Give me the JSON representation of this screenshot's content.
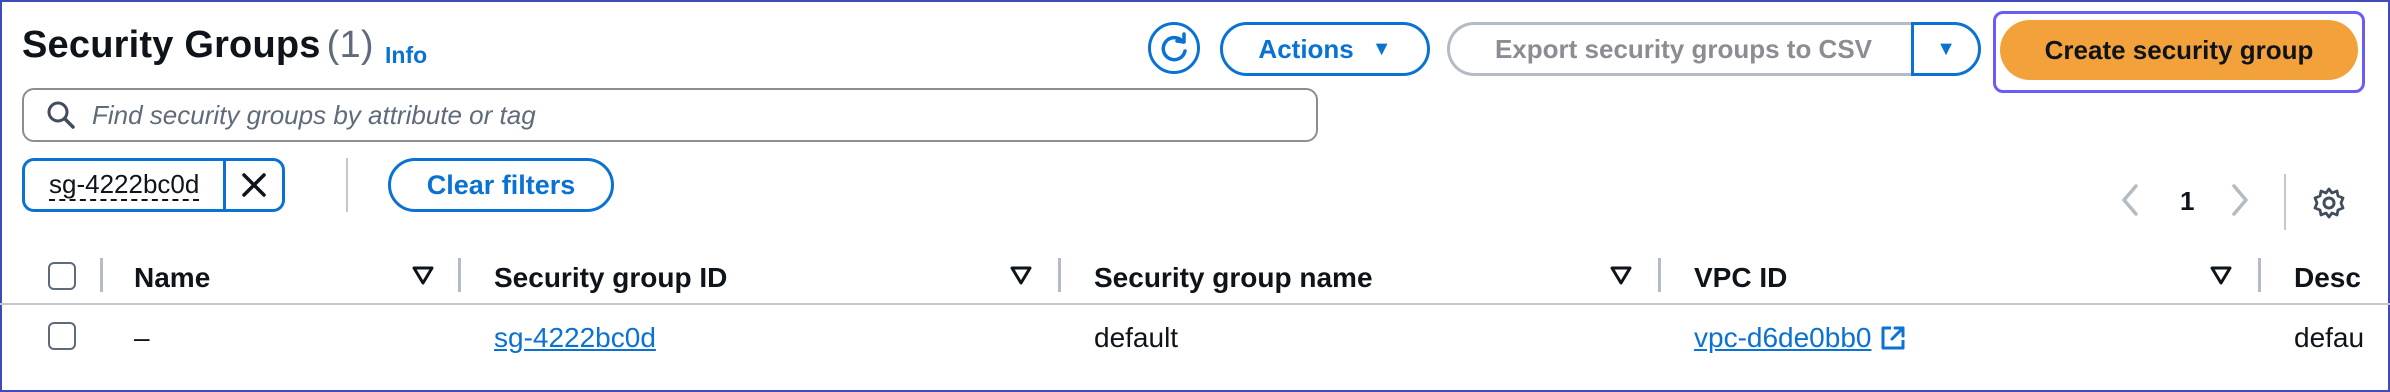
{
  "header": {
    "title": "Security Groups",
    "count": "(1)",
    "info_label": "Info"
  },
  "toolbar": {
    "actions_label": "Actions",
    "export_label": "Export security groups to CSV",
    "create_label": "Create security group"
  },
  "search": {
    "placeholder": "Find security groups by attribute or tag"
  },
  "filters": {
    "token_value": "sg-4222bc0d",
    "clear_label": "Clear filters"
  },
  "pagination": {
    "current_page": "1"
  },
  "table": {
    "columns": [
      "Name",
      "Security group ID",
      "Security group name",
      "VPC ID",
      "Desc"
    ],
    "rows": [
      {
        "name": "–",
        "security_group_id": "sg-4222bc0d",
        "security_group_name": "default",
        "vpc_id": "vpc-d6de0bb0",
        "description": "defau"
      }
    ]
  },
  "colors": {
    "accent": "#0972d3",
    "primary_button": "#f3a13a",
    "focus_outline": "#6a5cf5"
  },
  "icons": [
    "refresh-icon",
    "caret-down-icon",
    "search-icon",
    "close-icon",
    "chevron-left-icon",
    "chevron-right-icon",
    "gear-icon",
    "sort-icon",
    "external-link-icon"
  ]
}
